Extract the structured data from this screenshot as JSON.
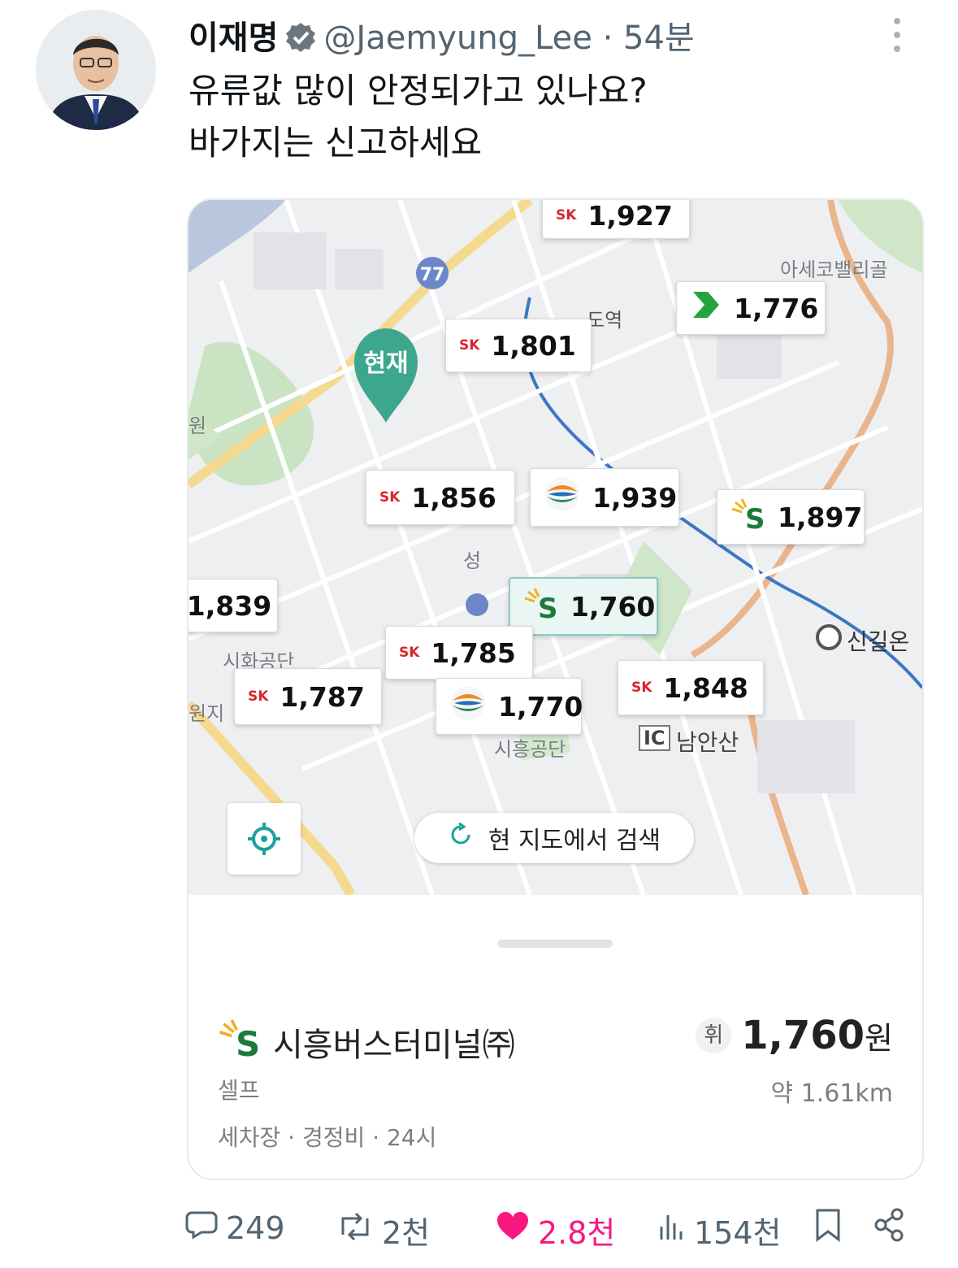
{
  "header": {
    "name": "이재명",
    "handle": "@Jaemyung_Lee",
    "separator": "·",
    "time": "54분"
  },
  "icons": {
    "verified": "verified-badge-icon",
    "more": "more-vertical-icon",
    "reply": "reply-icon",
    "retweet": "retweet-icon",
    "like": "heart-icon",
    "views": "views-icon",
    "bookmark": "bookmark-icon",
    "share": "share-icon",
    "locate": "crosshair-icon",
    "refresh": "refresh-icon"
  },
  "tweet": {
    "line1": "유류값 많이 안정되가고 있나요?",
    "line2": "바가지는 신고하세요"
  },
  "map": {
    "current_pin": "현재",
    "labels": {
      "area1": "아세코밸리골",
      "station": "도역",
      "area2": "원",
      "area3": "성",
      "area4": "시화공단",
      "area5": "원지",
      "area6": "시흥공단",
      "ic": "IC",
      "area7": "남안산",
      "area8": "신길온"
    },
    "route_badge": "77",
    "prices": {
      "p1927": "1,927",
      "p1776": "1,776",
      "p1801": "1,801",
      "p1856": "1,856",
      "p1939": "1,939",
      "p1897": "1,897",
      "p1839": "1,839",
      "p1760": "1,760",
      "p1785": "1,785",
      "p1787": "1,787",
      "p1770": "1,770",
      "p1848": "1,848"
    },
    "search_button": "현 지도에서 검색",
    "sk": "SK"
  },
  "station": {
    "name": "시흥버스터미널㈜",
    "fuel": "휘",
    "price": "1,760",
    "unit": "원",
    "type": "셀프",
    "distance": "약 1.61km",
    "amenities": "세차장 · 경정비 · 24시"
  },
  "stats": {
    "replies": "249",
    "retweets": "2천",
    "likes": "2.8천",
    "views": "154천"
  },
  "colors": {
    "like": "#f91880",
    "meta": "#536471",
    "teal": "#1aa39a",
    "sk_red": "#d9262c"
  }
}
